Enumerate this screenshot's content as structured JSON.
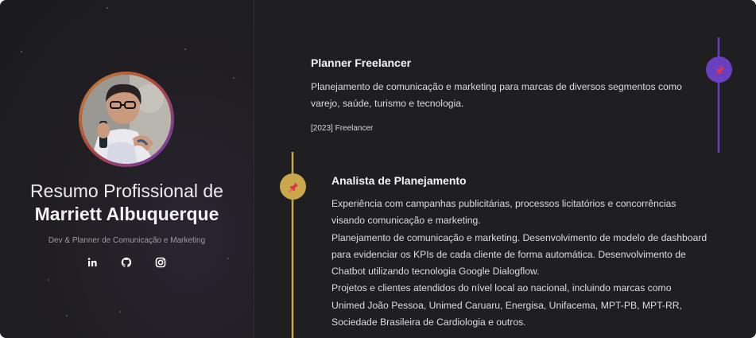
{
  "profile": {
    "title_line1": "Resumo Profissional de",
    "title_line2": "Marriett Albuquerque",
    "subtitle": "Dev & Planner de Comunicação e Marketing",
    "socials": [
      "linkedin-icon",
      "github-icon",
      "instagram-icon"
    ]
  },
  "experiences": [
    {
      "title": "Planner Freelancer",
      "description": [
        "Planejamento de comunicação e marketing para marcas de diversos segmentos como",
        "varejo, saúde, turismo e tecnologia."
      ],
      "meta": "[2023] Freelancer",
      "node_color": "#6a3fc0",
      "icon": "pin-icon"
    },
    {
      "title": "Analista de Planejamento",
      "description": [
        "Experiência com campanhas publicitárias, processos licitatórios e concorrências",
        "visando comunicação e marketing.",
        "Planejamento de comunicação e marketing. Desenvolvimento de modelo de dashboard",
        "para evidenciar os KPIs de cada cliente de forma automática. Desenvolvimento de",
        "Chatbot utilizando tecnologia Google Dialogflow.",
        "Projetos e clientes atendidos do nível local ao nacional, incluindo marcas como",
        "Unimed João Pessoa, Unimed Caruaru, Energisa, Unifacema, MPT-PB, MPT-RR,",
        "Sociedade Brasileira de Cardiologia e outros."
      ],
      "node_color": "#c9a74a",
      "icon": "pin-icon"
    }
  ],
  "colors": {
    "accent_purple": "#6a3fc0",
    "accent_gold": "#c9a74a",
    "pin_red": "#e0344a"
  }
}
